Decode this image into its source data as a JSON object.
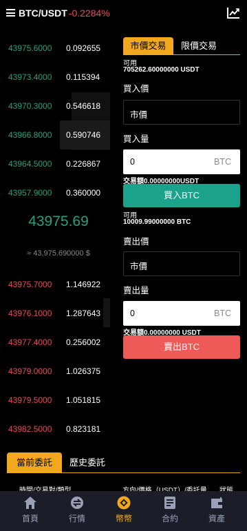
{
  "header": {
    "pair": "BTC/USDT",
    "change": "-0.2284%"
  },
  "orderbook": {
    "bids": [
      {
        "price": "43975.6000",
        "qty": "0.092655"
      },
      {
        "price": "43973.4000",
        "qty": "0.115394"
      },
      {
        "price": "43970.3000",
        "qty": "0.546618"
      },
      {
        "price": "43966.8000",
        "qty": "0.590746"
      },
      {
        "price": "43964.5000",
        "qty": "0.226867"
      },
      {
        "price": "43957.9000",
        "qty": "0.360000"
      }
    ],
    "last_price": "43975.69",
    "last_price_fiat": "≈ 43,975.690000 $",
    "asks": [
      {
        "price": "43975.7000",
        "qty": "1.146922"
      },
      {
        "price": "43976.1000",
        "qty": "1.287643"
      },
      {
        "price": "43977.4000",
        "qty": "0.256002"
      },
      {
        "price": "43979.0000",
        "qty": "1.026375"
      },
      {
        "price": "43979.5000",
        "qty": "1.051815"
      },
      {
        "price": "43982.5000",
        "qty": "0.823181"
      }
    ]
  },
  "trade": {
    "tabs": [
      "市價交易",
      "限價交易"
    ],
    "buy": {
      "available_label": "可用",
      "available_value": "705262.60000000 USDT",
      "price_label": "買入價",
      "price_value": "市價",
      "amount_label": "買入量",
      "amount_value": "0",
      "amount_unit": "BTC",
      "turnover": "交易額0.00000000USDT",
      "button": "買入BTC"
    },
    "sell": {
      "available_label": "可用",
      "available_value": "10009.99000000 BTC",
      "price_label": "賣出價",
      "price_value": "市價",
      "amount_label": "賣出量",
      "amount_value": "0",
      "amount_unit": "BTC",
      "turnover": "交易額0.00000000 USDT",
      "button": "賣出BTC"
    }
  },
  "orders": {
    "tabs": [
      "當前委託",
      "歷史委託"
    ],
    "columns": [
      "時間/交易對/類型",
      "方向/價格（USDT）/委託量",
      "狀態"
    ]
  },
  "nav": {
    "items": [
      {
        "label": "首頁",
        "icon": "home-icon"
      },
      {
        "label": "行情",
        "icon": "market-icon"
      },
      {
        "label": "幣幣",
        "icon": "coin-icon"
      },
      {
        "label": "合約",
        "icon": "contract-icon"
      },
      {
        "label": "資產",
        "icon": "wallet-icon"
      }
    ],
    "active_index": 2
  },
  "colors": {
    "green": "#26a17b",
    "red": "#ec4a4f",
    "accent": "#f1a81e",
    "buy_button": "#1aa38a",
    "sell_button": "#ee5a57",
    "nav_bg": "#1b1d28"
  }
}
